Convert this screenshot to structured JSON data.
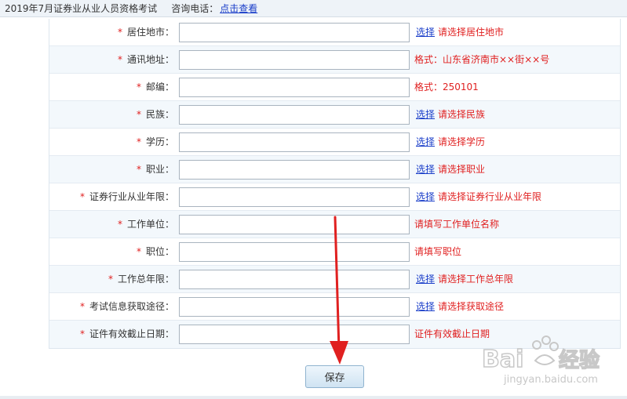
{
  "header": {
    "title": "2019年7月证券业从业人员资格考试",
    "phone_label": "咨询电话：",
    "phone_link": "点击查看"
  },
  "form": {
    "rows": [
      {
        "label": "居住地市：",
        "required": "*",
        "pick": "选择",
        "hint": "请选择居住地市"
      },
      {
        "label": "通讯地址：",
        "required": "*",
        "pick": "",
        "hint": "格式：山东省济南市××街××号"
      },
      {
        "label": "邮编：",
        "required": "*",
        "pick": "",
        "hint": "格式：250101"
      },
      {
        "label": "民族：",
        "required": "*",
        "pick": "选择",
        "hint": "请选择民族"
      },
      {
        "label": "学历：",
        "required": "*",
        "pick": "选择",
        "hint": "请选择学历"
      },
      {
        "label": "职业：",
        "required": "*",
        "pick": "选择",
        "hint": "请选择职业"
      },
      {
        "label": "证券行业从业年限：",
        "required": "*",
        "pick": "选择",
        "hint": "请选择证券行业从业年限"
      },
      {
        "label": "工作单位：",
        "required": "*",
        "pick": "",
        "hint": "请填写工作单位名称"
      },
      {
        "label": "职位：",
        "required": "*",
        "pick": "",
        "hint": "请填写职位"
      },
      {
        "label": "工作总年限：",
        "required": "*",
        "pick": "选择",
        "hint": "请选择工作总年限"
      },
      {
        "label": "考试信息获取途径：",
        "required": "*",
        "pick": "选择",
        "hint": "请选择获取途径"
      },
      {
        "label": "证件有效截止日期：",
        "required": "*",
        "pick": "",
        "hint": "证件有效截止日期"
      }
    ]
  },
  "actions": {
    "save_label": "保存"
  },
  "colors": {
    "required": "#e02020",
    "link": "#1a3ec9",
    "row_alt": "#f3f8fc",
    "arrow": "#e02020"
  },
  "watermark": {
    "brand": "Baidu经验",
    "url": "jingyan.baidu.com"
  }
}
